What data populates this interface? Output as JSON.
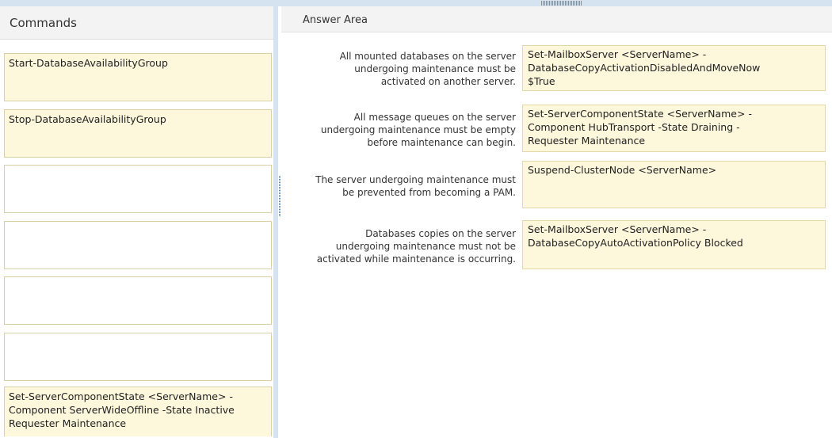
{
  "commands_pane": {
    "title": "Commands",
    "items": [
      {
        "text": "Start-DatabaseAvailabilityGroup"
      },
      {
        "text": "Stop-DatabaseAvailabilityGroup"
      },
      {
        "text": ""
      },
      {
        "text": ""
      },
      {
        "text": ""
      },
      {
        "text": ""
      },
      {
        "text": "Set-ServerComponentState <ServerName> -\nComponent ServerWideOffline -State Inactive\nRequester Maintenance"
      }
    ]
  },
  "answer_area": {
    "title": "Answer Area",
    "rows": [
      {
        "requirement": "All mounted databases on the server\nundergoing maintenance must be\nactivated on another server.",
        "answer": "Set-MailboxServer <ServerName> -\nDatabaseCopyActivationDisabledAndMoveNow\n$True"
      },
      {
        "requirement": "All message queues on the server\nundergoing maintenance must be empty\nbefore maintenance can begin.",
        "answer": "Set-ServerComponentState <ServerName> -\nComponent HubTransport -State Draining -\nRequester Maintenance"
      },
      {
        "requirement": "The server undergoing maintenance must\nbe prevented from becoming a PAM.",
        "answer": "Suspend-ClusterNode <ServerName>"
      },
      {
        "requirement": "Databases copies on the server\nundergoing maintenance must not be\nactivated while maintenance is occurring.",
        "answer": "Set-MailboxServer <ServerName> -\nDatabaseCopyAutoActivationPolicy Blocked"
      }
    ]
  }
}
